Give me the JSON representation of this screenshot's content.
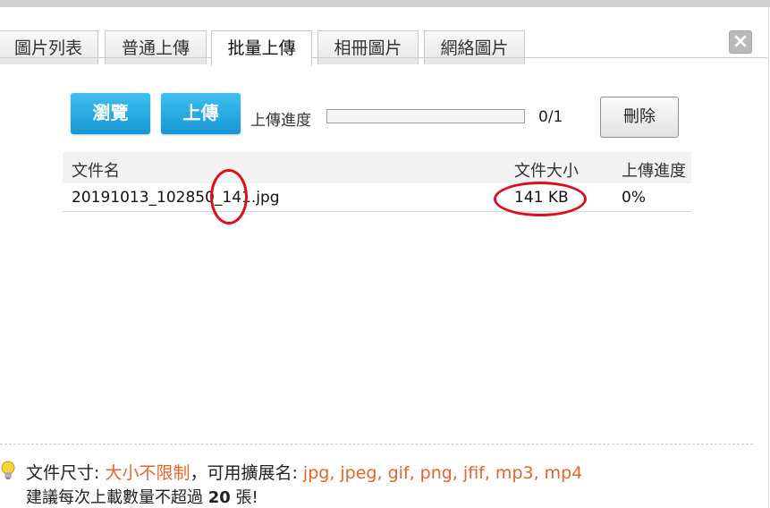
{
  "tabs": [
    {
      "label": "圖片列表",
      "active": false
    },
    {
      "label": "普通上傳",
      "active": false
    },
    {
      "label": "批量上傳",
      "active": true
    },
    {
      "label": "相冊圖片",
      "active": false
    },
    {
      "label": "網絡圖片",
      "active": false
    }
  ],
  "close_label": "×",
  "toolbar": {
    "browse_label": "瀏覽",
    "upload_label": "上傳",
    "progress_label": "上傳進度",
    "progress_fraction": 0,
    "progress_count": "0/1",
    "delete_label": "刪除"
  },
  "table": {
    "columns": [
      "文件名",
      "文件大小",
      "上傳進度"
    ],
    "rows": [
      {
        "filename": "20191013_102850_141.jpg",
        "size": "141 KB",
        "progress": "0%"
      }
    ]
  },
  "annotation_color": "#d8101f",
  "footer": {
    "size_label": "文件尺寸: ",
    "size_value": "大小不限制",
    "ext_label": "，可用擴展名: ",
    "ext_value": "jpg, jpeg, gif, png, jfif, mp3, mp4",
    "advice_prefix": "建議每次上載數量不超過 ",
    "advice_count": "20",
    "advice_suffix": " 張!"
  },
  "colors": {
    "accent_blue": "#1696d4",
    "highlight_orange": "#e0662f",
    "icon_bulb": "lightbulb-icon"
  }
}
